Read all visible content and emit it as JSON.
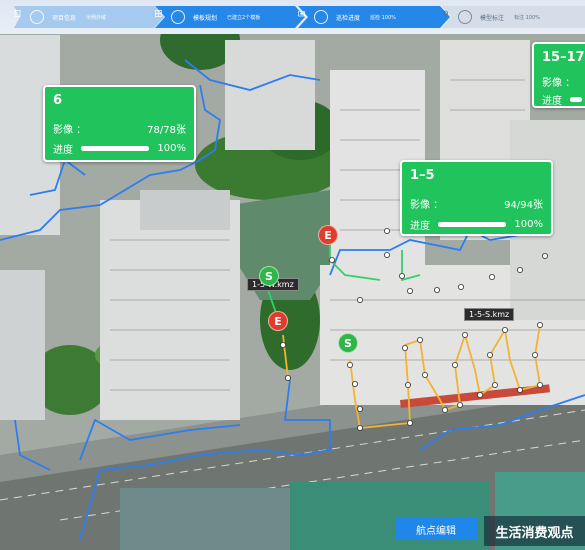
{
  "steps": [
    {
      "title": "项目信息",
      "detail": "示例外域",
      "state": "done",
      "icon": "document-icon"
    },
    {
      "title": "模板规划",
      "detail": "已建立2个模板",
      "state": "active",
      "icon": "grid-icon"
    },
    {
      "title": "巡检进度",
      "detail": "巡检 100%",
      "state": "active",
      "icon": "camera-icon"
    },
    {
      "title": "模型标注",
      "detail": "标注 100%",
      "state": "pending",
      "icon": "pin-icon"
    }
  ],
  "cards": [
    {
      "name": "6",
      "image_label": "影像 ：",
      "image_value": "78/78张",
      "progress_label": "进度",
      "progress_value": "100%",
      "progress": 1.0
    },
    {
      "name": "1–5",
      "image_label": "影像 ：",
      "image_value": "94/94张",
      "progress_label": "进度",
      "progress_value": "100%",
      "progress": 1.0
    },
    {
      "name": "15–17",
      "image_label": "影像 ：",
      "image_value": "",
      "progress_label": "进度",
      "progress_value": "",
      "progress": 1.0
    }
  ],
  "markers": {
    "start": "S",
    "end": "E"
  },
  "route_labels": [
    "1-5-W.kmz",
    "1-5-S.kmz"
  ],
  "bottom": {
    "edit_label": "航点编辑",
    "watermark": "生活消费观点"
  },
  "colors": {
    "accent": "#1f86ea",
    "card": "#21c45c",
    "start": "#2fb548",
    "end": "#e03c2e",
    "route_blue": "#2d7df0",
    "route_yellow": "#f2b233"
  }
}
